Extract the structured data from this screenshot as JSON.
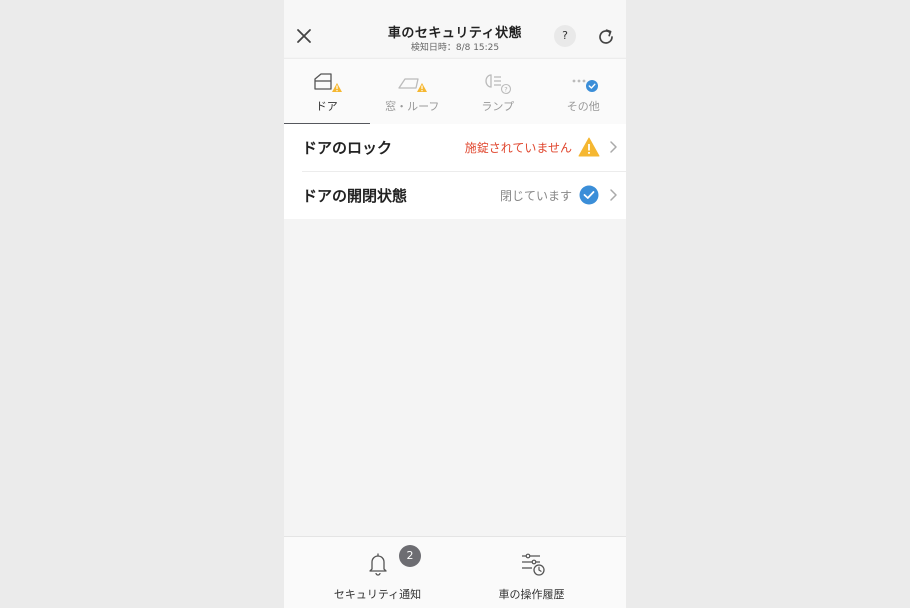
{
  "header": {
    "title": "車のセキュリティ状態",
    "subtitle": "検知日時：8/8 15:25",
    "help_label": "?",
    "icons": {
      "close": "close-icon",
      "refresh": "refresh-icon"
    }
  },
  "tabs": [
    {
      "label": "ドア",
      "icon": "door-icon",
      "status": "warning",
      "active": true
    },
    {
      "label": "窓・ルーフ",
      "icon": "window-icon",
      "status": "warning",
      "active": false
    },
    {
      "label": "ランプ",
      "icon": "lamp-icon",
      "status": "unknown",
      "active": false
    },
    {
      "label": "その他",
      "icon": "more-icon",
      "status": "ok",
      "active": false
    }
  ],
  "items": [
    {
      "label": "ドアのロック",
      "status": "施錠されていません",
      "status_type": "warning"
    },
    {
      "label": "ドアの開閉状態",
      "status": "閉じています",
      "status_type": "ok"
    }
  ],
  "bottom_nav": [
    {
      "label": "セキュリティ通知",
      "icon": "bell-icon",
      "badge": "2"
    },
    {
      "label": "車の操作履歴",
      "icon": "history-icon"
    }
  ],
  "colors": {
    "warning_text": "#e0472f",
    "warning_icon": "#f5b731",
    "ok_icon": "#3b8ed8",
    "indicator": "#55575d",
    "badge": "#6d6d72"
  }
}
